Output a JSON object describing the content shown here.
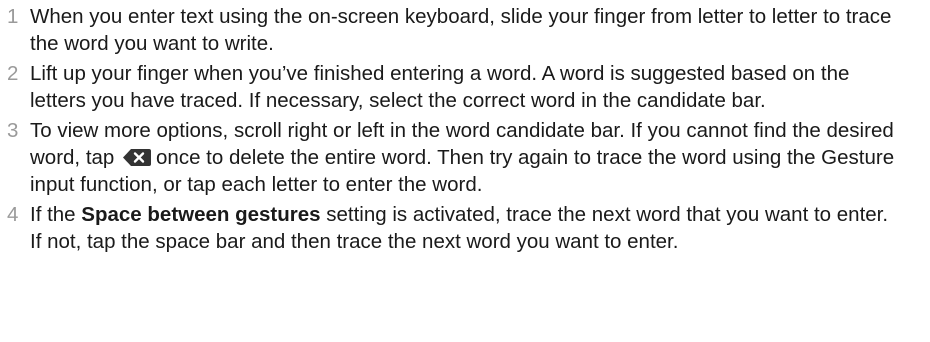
{
  "steps": [
    {
      "number": "1",
      "text": "When you enter text using the on-screen keyboard, slide your finger from letter to letter to trace the word you want to write."
    },
    {
      "number": "2",
      "text": "Lift up your finger when you’ve finished entering a word. A word is suggested based on the letters you have traced. If necessary, select the correct word in the candidate bar."
    },
    {
      "number": "3",
      "text_before_icon": "To view more options, scroll right or left in the word candidate bar. If you cannot find the desired word, tap",
      "icon": "backspace-delete-icon",
      "text_after_icon": "once to delete the entire word. Then try again to trace the word using the Gesture input function, or tap each letter to enter the word."
    },
    {
      "number": "4",
      "text_before_bold": "If the",
      "bold": "Space between gestures",
      "text_after_bold": "setting is activated, trace the next word that you want to enter. If not, tap the space bar and then trace the next word you want to enter."
    }
  ],
  "colors": {
    "number": "#9a9a9a",
    "text": "#1a1a1a",
    "icon": "#333333"
  }
}
